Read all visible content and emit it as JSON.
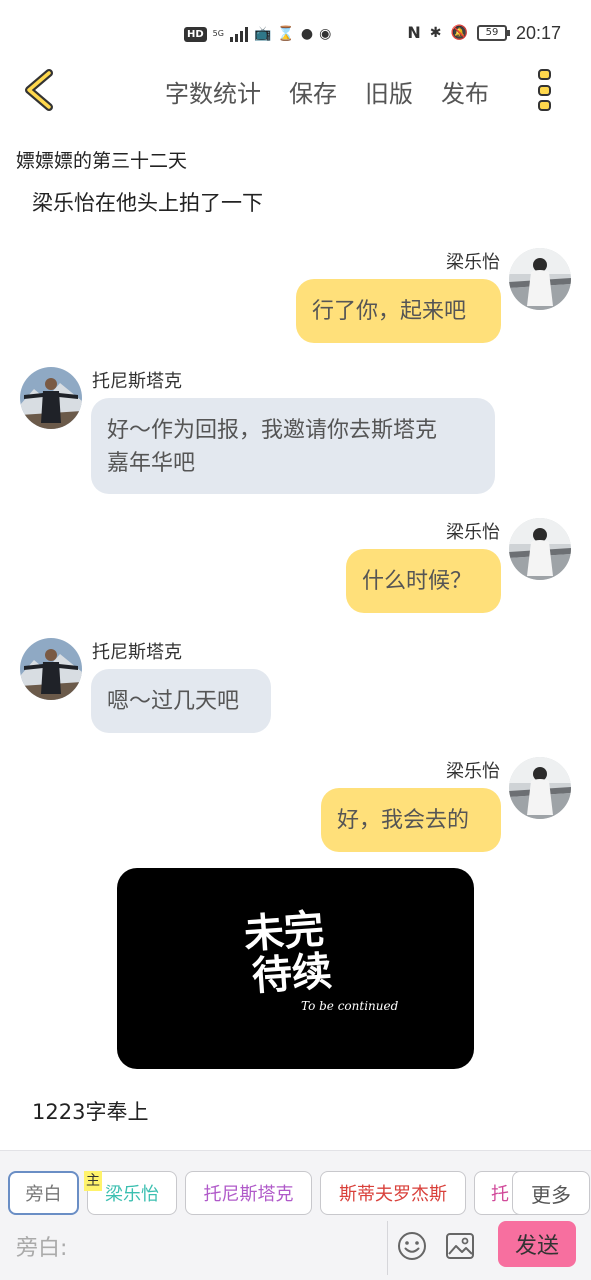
{
  "status_bar": {
    "hd": "HD",
    "network_tag": "5G",
    "battery": "59",
    "time": "20:17"
  },
  "nav": {
    "actions": [
      "字数统计",
      "保存",
      "旧版",
      "发布"
    ]
  },
  "story": {
    "chapter_title": "嫖嫖嫖的第三十二天",
    "narration": "梁乐怡在他头上拍了一下",
    "footer_note": "1223字奉上"
  },
  "messages": [
    {
      "sender": "梁乐怡",
      "side": "right",
      "text_lines": [
        "行了你，起来吧"
      ]
    },
    {
      "sender": "托尼斯塔克",
      "side": "left",
      "text_lines": [
        "好～作为回报，我邀请你去斯塔克",
        "嘉年华吧"
      ]
    },
    {
      "sender": "梁乐怡",
      "side": "right",
      "text_lines": [
        "什么时候？"
      ]
    },
    {
      "sender": "托尼斯塔克",
      "side": "left",
      "text_lines": [
        "嗯～过几天吧"
      ]
    },
    {
      "sender": "梁乐怡",
      "side": "right",
      "text_lines": [
        "好，我会去的"
      ]
    }
  ],
  "image_card": {
    "line1": "未完",
    "line2": "待续",
    "caption": "To be continued"
  },
  "toolbar": {
    "roles": [
      {
        "label": "旁白",
        "color": "#777777"
      },
      {
        "label": "梁乐怡",
        "color": "#3bbfb0"
      },
      {
        "label": "托尼斯塔克",
        "color": "#b05ac9"
      },
      {
        "label": "斯蒂夫罗杰斯",
        "color": "#d9413b"
      },
      {
        "label": "托",
        "color": "#d14a9a"
      }
    ],
    "host_badge": "主",
    "more_label": "更多",
    "input_placeholder": "旁白:",
    "send_label": "发送"
  }
}
